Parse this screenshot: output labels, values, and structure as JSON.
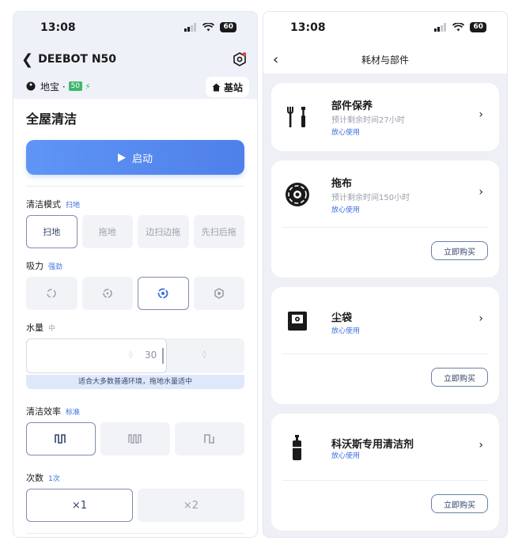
{
  "status_bar": {
    "time": "13:08",
    "battery": "60"
  },
  "left": {
    "title": "DEEBOT N50",
    "device_name": "地宝 ·",
    "device_battery": "50",
    "base_label": "基站",
    "page_title": "全屋清洁",
    "start_label": "启动",
    "clean_mode": {
      "label": "清洁模式",
      "value": "扫地",
      "options": [
        "扫地",
        "拖地",
        "边扫边拖",
        "先扫后拖"
      ],
      "selected": 0
    },
    "suction": {
      "label": "吸力",
      "value": "强劲",
      "selected": 2
    },
    "water": {
      "label": "水量",
      "value": "中",
      "level": 30,
      "hint": "适合大多数普通环境，拖地水量适中"
    },
    "efficiency": {
      "label": "清洁效率",
      "value": "标准",
      "selected": 0
    },
    "count": {
      "label": "次数",
      "value": "1次",
      "options": [
        "×1",
        "×2"
      ],
      "selected": 0
    }
  },
  "right": {
    "title": "耗材与部件",
    "parts": [
      {
        "name": "部件保养",
        "remaining": "预计剩余时间27小时",
        "status": "放心使用",
        "icon": "tools-icon"
      },
      {
        "name": "拖布",
        "remaining": "预计剩余时间150小时",
        "status": "放心使用",
        "buy": "立即购买",
        "icon": "mop-icon"
      },
      {
        "name": "尘袋",
        "status": "放心使用",
        "buy": "立即购买",
        "icon": "dust-bag-icon"
      },
      {
        "name": "科沃斯专用清洁剂",
        "status": "放心使用",
        "buy": "立即购买",
        "icon": "cleaner-bottle-icon"
      }
    ]
  },
  "colors": {
    "accent": "#4f80ea",
    "selected_border": "#7f8cad",
    "battery_green": "#3fb86b"
  }
}
